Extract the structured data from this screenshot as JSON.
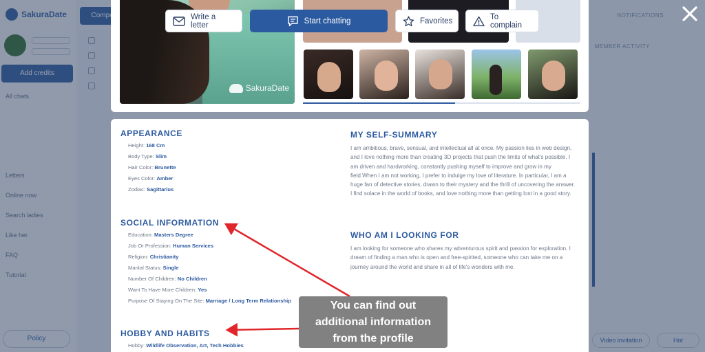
{
  "background": {
    "logo": "SakuraDate",
    "compose_label": "Compose new letter",
    "create_label": "Add credits",
    "nav": [
      "All chats",
      "Letters",
      "Online now",
      "Search ladies",
      "Like her",
      "FAQ",
      "Tutorial"
    ],
    "right_header": "NOTIFICATIONS",
    "right_sub": "MEMBER ACTIVITY",
    "bottom_left": "Policy",
    "bottom_right": [
      "Video invitation",
      "Hot"
    ]
  },
  "actions": {
    "write_letter": "Write a letter",
    "start_chatting": "Start chatting",
    "favorites": "Favorites",
    "complain": "To complain"
  },
  "colors": {
    "accent": "#2c5aa0",
    "annotation": "#e0262a"
  },
  "gallery": {
    "watermark": "SakuraDate",
    "thumb_count": 5,
    "progress_fraction": 0.55
  },
  "appearance": {
    "title": "APPEARANCE",
    "fields": [
      {
        "label": "Height:",
        "value": "168 Cm"
      },
      {
        "label": "Body Type:",
        "value": "Slim"
      },
      {
        "label": "Hair Color:",
        "value": "Brunette"
      },
      {
        "label": "Eyes Color:",
        "value": "Amber"
      },
      {
        "label": "Zodiac:",
        "value": "Sagittarius"
      }
    ]
  },
  "social": {
    "title": "SOCIAL INFORMATION",
    "fields": [
      {
        "label": "Education:",
        "value": "Masters Degree"
      },
      {
        "label": "Job Or Profession:",
        "value": "Human Services"
      },
      {
        "label": "Religion:",
        "value": "Christianity"
      },
      {
        "label": "Marital Status:",
        "value": "Single"
      },
      {
        "label": "Number Of Children:",
        "value": "No Children"
      },
      {
        "label": "Want To Have More Children:",
        "value": "Yes"
      },
      {
        "label": "Purpose Of Staying On The Site:",
        "value": "Marriage / Long Term Relationship"
      }
    ]
  },
  "hobby": {
    "title": "HOBBY AND HABITS",
    "fields": [
      {
        "label": "Hobby:",
        "value": "Wildlife Observation, Art, Tech Hobbies"
      }
    ]
  },
  "summary": {
    "title": "MY SELF-SUMMARY",
    "text": "I am ambitious, brave, sensual, and intellectual all at once. My passion lies in web design, and I love nothing more than creating 3D projects that push the limits of what's possible. I am driven and hardworking, constantly pushing myself to improve and grow in my field.When I am not working, I prefer to indulge my love of literature. In particular, I am a huge fan of detective stories, drawn to their mystery and the thrill of uncovering the answer. I find solace in the world of books, and love nothing more than getting lost in a good story."
  },
  "looking": {
    "title": "WHO AM I LOOKING FOR",
    "text": "I am looking for someone who shares my adventurous spirit and passion for exploration. I dream of finding a man who is open and free-spirited, someone who can take me on a journey around the world and share in all of life's wonders with me."
  },
  "annotation": {
    "lines": [
      "You can find out",
      "additional information",
      "from the profile"
    ]
  }
}
